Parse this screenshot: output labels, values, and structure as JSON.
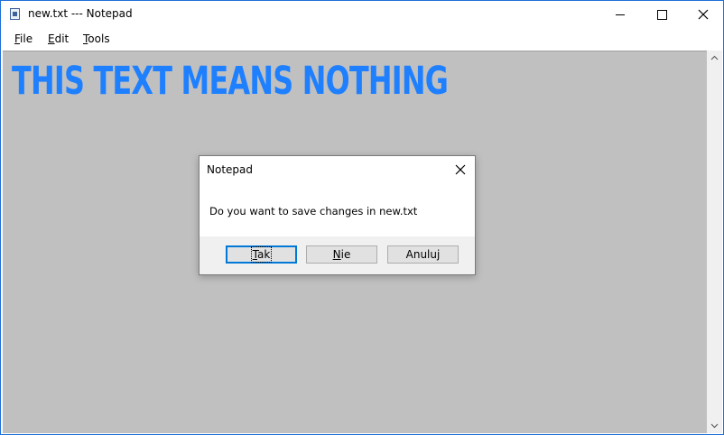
{
  "window": {
    "title": "new.txt --- Notepad"
  },
  "menu": {
    "file": {
      "mnemonic": "F",
      "rest": "ile"
    },
    "edit": {
      "mnemonic": "E",
      "rest": "dit"
    },
    "tools": {
      "mnemonic": "T",
      "rest": "ools"
    }
  },
  "editor": {
    "content": "THIS TEXT MEANS NOTHING",
    "text_color": "#1e80ff",
    "background": "#c0c0c0"
  },
  "dialog": {
    "title": "Notepad",
    "message": "Do you want to save changes in new.txt",
    "buttons": {
      "tak": {
        "mnemonic": "T",
        "rest": "ak"
      },
      "nie": {
        "mnemonic": "N",
        "rest": "ie"
      },
      "anuluj": {
        "label": "Anuluj"
      }
    }
  },
  "icons": [
    "notepad-app-icon",
    "minimize-icon",
    "maximize-icon",
    "close-icon",
    "scroll-up-arrow-icon",
    "scroll-down-arrow-icon",
    "dialog-close-icon"
  ]
}
